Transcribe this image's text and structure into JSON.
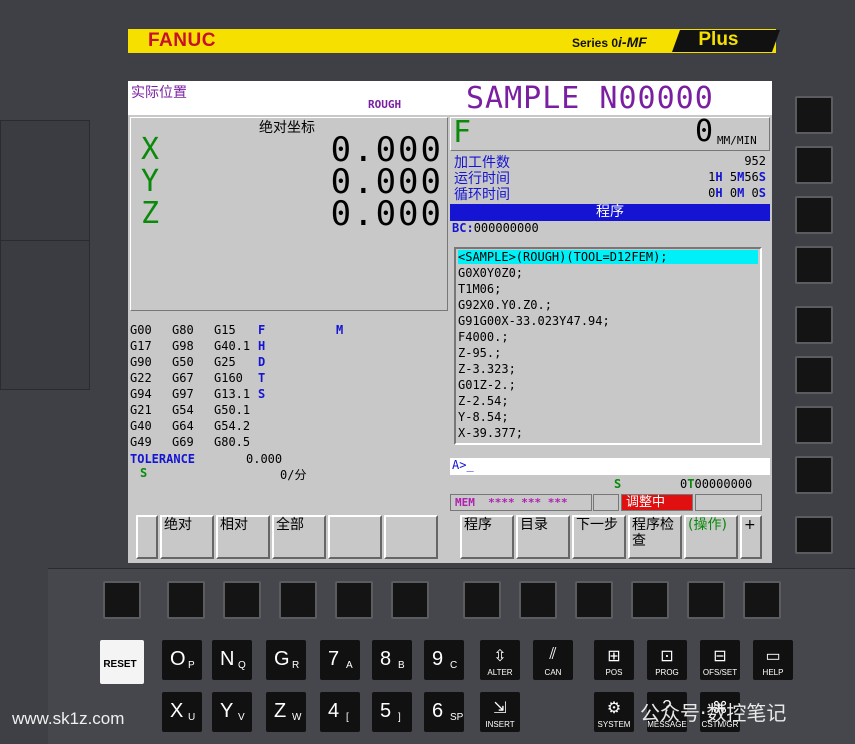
{
  "brand": {
    "logo": "FANUC",
    "series_prefix": "Series 0",
    "series_suffix": "i-MF",
    "plus": "Plus"
  },
  "header": {
    "screen_name": "实际位置",
    "mode": "ROUGH",
    "program": "SAMPLE N00000"
  },
  "position": {
    "title": "绝对坐标",
    "axes": [
      {
        "label": "X",
        "value": "0.000"
      },
      {
        "label": "Y",
        "value": "0.000"
      },
      {
        "label": "Z",
        "value": "0.000"
      }
    ]
  },
  "gcodes": {
    "rows": [
      [
        "G00",
        "G80",
        "G15"
      ],
      [
        "G17",
        "G98",
        "G40.1"
      ],
      [
        "G90",
        "G50",
        "G25"
      ],
      [
        "G22",
        "G67",
        "G160"
      ],
      [
        "G94",
        "G97",
        "G13.1"
      ],
      [
        "G21",
        "G54",
        "G50.1"
      ],
      [
        "G40",
        "G64",
        "G54.2"
      ],
      [
        "G49",
        "G69",
        "G80.5"
      ]
    ],
    "letters": [
      "F",
      "H",
      "D",
      "T",
      "S"
    ],
    "m_letter": "M",
    "tolerance_label": "TOLERANCE",
    "tolerance_value": "0.000",
    "s_label": "S",
    "s_value": "0/分"
  },
  "feed": {
    "label": "F",
    "value": "0",
    "unit": "MM/MIN"
  },
  "info": {
    "parts_label": "加工件数",
    "parts_value": "952",
    "run_label": "运行时间",
    "run_h": "1",
    "run_m": "5",
    "run_s": "56",
    "cycle_label": "循环时间",
    "cycle_h": "0",
    "cycle_m": "0",
    "cycle_s": "0",
    "h_unit": "H",
    "m_unit": "M",
    "s_unit": "S"
  },
  "program": {
    "title": "程序",
    "bc_label": "BC:",
    "bc_value": "000000000",
    "lines": [
      "<SAMPLE>(ROUGH)(TOOL=D12FEM);",
      "G0X0Y0Z0;",
      "T1M06;",
      "G92X0.Y0.Z0.;",
      "G91G00X-33.023Y47.94;",
      "F4000.;",
      "Z-95.;",
      "Z-3.323;",
      "G01Z-2.;",
      "Z-2.54;",
      "Y-8.54;",
      "X-39.377;"
    ]
  },
  "input_prompt": "A>_",
  "status": {
    "s_label": "S",
    "s_value": "0",
    "t_label": "T",
    "t_value": "00000000",
    "mem": "MEM",
    "stars": "**** *** ***",
    "adjusting": "调整中"
  },
  "softkeys": {
    "left": [
      "绝对",
      "相对",
      "全部",
      "",
      ""
    ],
    "right": [
      "程序",
      "目录",
      "下一步",
      "程序检查",
      "(操作)"
    ],
    "more": "+"
  },
  "keypad": {
    "reset": "RESET",
    "row1": [
      {
        "main": "O",
        "sub": "P"
      },
      {
        "main": "N",
        "sub": "Q"
      },
      {
        "main": "G",
        "sub": "R"
      },
      {
        "main": "7",
        "sub": "A"
      },
      {
        "main": "8",
        "sub": "B"
      },
      {
        "main": "9",
        "sub": "C"
      }
    ],
    "row2": [
      {
        "main": "X",
        "sub": "U"
      },
      {
        "main": "Y",
        "sub": "V"
      },
      {
        "main": "Z",
        "sub": "W"
      },
      {
        "main": "4",
        "sub": "["
      },
      {
        "main": "5",
        "sub": "]"
      },
      {
        "main": "6",
        "sub": "SP"
      }
    ],
    "edit_row1": [
      "ALTER",
      "CAN"
    ],
    "edit_row2": [
      "INSERT"
    ],
    "func_row1": [
      "POS",
      "PROG",
      "OFS/SET",
      "HELP"
    ],
    "func_row2": [
      "SYSTEM",
      "MESSAGE",
      "CSTM/GR"
    ]
  },
  "watermarks": {
    "left": "www.sk1z.com",
    "right": "公众号·数控笔记"
  }
}
